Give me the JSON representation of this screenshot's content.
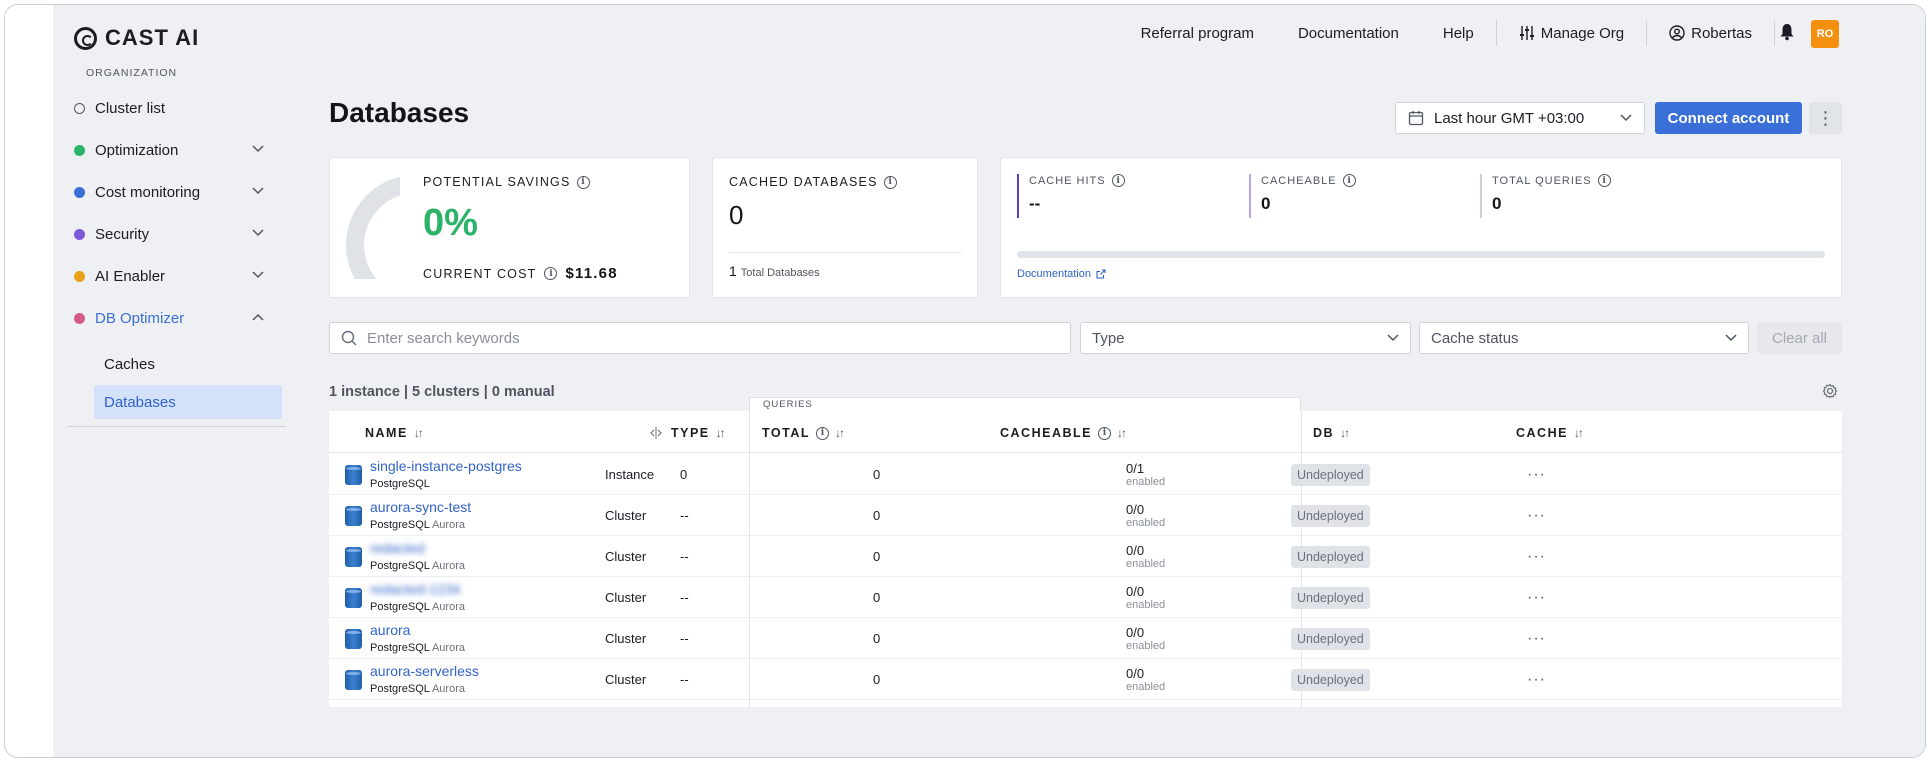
{
  "brand": {
    "name": "CAST AI"
  },
  "sidebar": {
    "section_label": "ORGANIZATION",
    "items": [
      {
        "label": "Cluster list",
        "dot_color": "#ffffff",
        "has_chevron": false
      },
      {
        "label": "Optimization",
        "dot_color": "#2bb36a",
        "has_chevron": true
      },
      {
        "label": "Cost monitoring",
        "dot_color": "#3b6fd8",
        "has_chevron": true
      },
      {
        "label": "Security",
        "dot_color": "#7a5ad8",
        "has_chevron": true
      },
      {
        "label": "AI Enabler",
        "dot_color": "#e8a21b",
        "has_chevron": true
      },
      {
        "label": "DB Optimizer",
        "dot_color": "#d65a8c",
        "has_chevron": true,
        "expanded": true
      }
    ],
    "subitems": [
      {
        "label": "Caches",
        "selected": false
      },
      {
        "label": "Databases",
        "selected": true
      }
    ]
  },
  "topnav": {
    "links": [
      "Referral program",
      "Documentation",
      "Help"
    ],
    "manage_org": "Manage Org",
    "user": "Robertas",
    "avatar_initials": "RO"
  },
  "page": {
    "title": "Databases",
    "date_range": "Last hour GMT +03:00",
    "connect_label": "Connect account",
    "kebab": "⋮"
  },
  "cards": {
    "savings": {
      "label": "POTENTIAL SAVINGS",
      "value": "0%",
      "current_cost_label": "CURRENT COST",
      "current_cost_value": "$11.68"
    },
    "cached": {
      "label": "CACHED DATABASES",
      "value": "0",
      "total_count": "1",
      "total_label": "Total Databases"
    },
    "metrics": [
      {
        "label": "CACHE HITS",
        "value": "--"
      },
      {
        "label": "CACHEABLE",
        "value": "0"
      },
      {
        "label": "TOTAL QUERIES",
        "value": "0"
      }
    ],
    "doc_link": "Documentation"
  },
  "filters": {
    "search_placeholder": "Enter search keywords",
    "type_placeholder": "Type",
    "cache_placeholder": "Cache status",
    "clear_label": "Clear all"
  },
  "summary": "1 instance | 5 clusters | 0 manual",
  "table": {
    "group_label": "QUERIES",
    "headers": {
      "name": "NAME",
      "type": "TYPE",
      "total": "TOTAL",
      "cacheable": "CACHEABLE",
      "db": "DB",
      "cache": "CACHE"
    },
    "rows": [
      {
        "name": "single-instance-postgres",
        "engine": "PostgreSQL",
        "flavor": "",
        "type": "Instance",
        "total": "0",
        "cacheable": "0",
        "db": "0/1",
        "db_sub": "enabled",
        "cache": "Undeployed",
        "blurred": false
      },
      {
        "name": "aurora-sync-test",
        "engine": "PostgreSQL",
        "flavor": "Aurora",
        "type": "Cluster",
        "total": "--",
        "cacheable": "0",
        "db": "0/0",
        "db_sub": "enabled",
        "cache": "Undeployed",
        "blurred": false
      },
      {
        "name": "redacted",
        "engine": "PostgreSQL",
        "flavor": "Aurora",
        "type": "Cluster",
        "total": "--",
        "cacheable": "0",
        "db": "0/0",
        "db_sub": "enabled",
        "cache": "Undeployed",
        "blurred": true
      },
      {
        "name": "redacted-1234",
        "engine": "PostgreSQL",
        "flavor": "Aurora",
        "type": "Cluster",
        "total": "--",
        "cacheable": "0",
        "db": "0/0",
        "db_sub": "enabled",
        "cache": "Undeployed",
        "blurred": true
      },
      {
        "name": "aurora",
        "engine": "PostgreSQL",
        "flavor": "Aurora",
        "type": "Cluster",
        "total": "--",
        "cacheable": "0",
        "db": "0/0",
        "db_sub": "enabled",
        "cache": "Undeployed",
        "blurred": false
      },
      {
        "name": "aurora-serverless",
        "engine": "PostgreSQL",
        "flavor": "Aurora",
        "type": "Cluster",
        "total": "--",
        "cacheable": "0",
        "db": "0/0",
        "db_sub": "enabled",
        "cache": "Undeployed",
        "blurred": false
      }
    ]
  }
}
